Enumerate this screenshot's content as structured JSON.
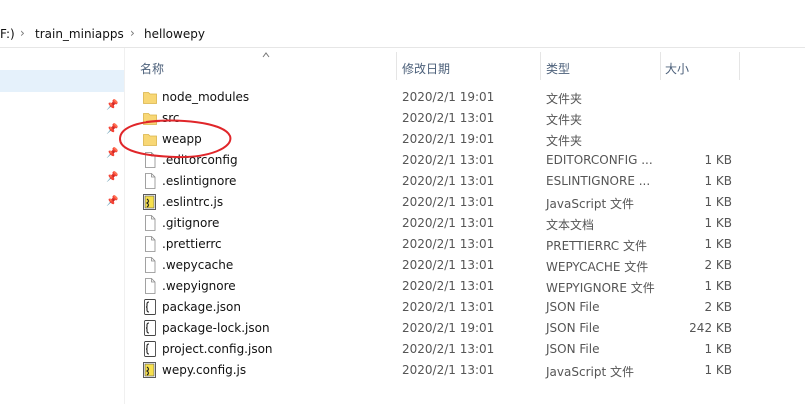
{
  "breadcrumb": {
    "drive_fragment": "F:)",
    "folder1": "train_miniapps",
    "folder2": "hellowepy"
  },
  "columns": {
    "name": "名称",
    "date": "修改日期",
    "type": "类型",
    "size": "大小"
  },
  "files": [
    {
      "name": "node_modules",
      "date": "2020/2/1 19:01",
      "type": "文件夹",
      "size": "",
      "icon": "folder-icon"
    },
    {
      "name": "src",
      "date": "2020/2/1 13:01",
      "type": "文件夹",
      "size": "",
      "icon": "folder-icon"
    },
    {
      "name": "weapp",
      "date": "2020/2/1 19:01",
      "type": "文件夹",
      "size": "",
      "icon": "folder-icon"
    },
    {
      "name": ".editorconfig",
      "date": "2020/2/1 13:01",
      "type": "EDITORCONFIG ...",
      "size": "1 KB",
      "icon": "file-icon"
    },
    {
      "name": ".eslintignore",
      "date": "2020/2/1 13:01",
      "type": "ESLINTIGNORE ...",
      "size": "1 KB",
      "icon": "file-icon"
    },
    {
      "name": ".eslintrc.js",
      "date": "2020/2/1 13:01",
      "type": "JavaScript 文件",
      "size": "1 KB",
      "icon": "js-file-icon"
    },
    {
      "name": ".gitignore",
      "date": "2020/2/1 13:01",
      "type": "文本文档",
      "size": "1 KB",
      "icon": "file-icon"
    },
    {
      "name": ".prettierrc",
      "date": "2020/2/1 13:01",
      "type": "PRETTIERRC 文件",
      "size": "1 KB",
      "icon": "file-icon"
    },
    {
      "name": ".wepycache",
      "date": "2020/2/1 13:01",
      "type": "WEPYCACHE 文件",
      "size": "2 KB",
      "icon": "file-icon"
    },
    {
      "name": ".wepyignore",
      "date": "2020/2/1 13:01",
      "type": "WEPYIGNORE 文件",
      "size": "1 KB",
      "icon": "file-icon"
    },
    {
      "name": "package.json",
      "date": "2020/2/1 13:01",
      "type": "JSON File",
      "size": "2 KB",
      "icon": "json-file-icon"
    },
    {
      "name": "package-lock.json",
      "date": "2020/2/1 19:01",
      "type": "JSON File",
      "size": "242 KB",
      "icon": "json-file-icon"
    },
    {
      "name": "project.config.json",
      "date": "2020/2/1 13:01",
      "type": "JSON File",
      "size": "1 KB",
      "icon": "json-file-icon"
    },
    {
      "name": "wepy.config.js",
      "date": "2020/2/1 13:01",
      "type": "JavaScript 文件",
      "size": "1 KB",
      "icon": "js-file-icon"
    }
  ],
  "annotation": {
    "highlighted_item": "weapp",
    "color": "#e0262a"
  },
  "colors": {
    "folder": "#f8d775",
    "nav_selection": "#e5f1fb",
    "header_text": "#4c607a"
  }
}
